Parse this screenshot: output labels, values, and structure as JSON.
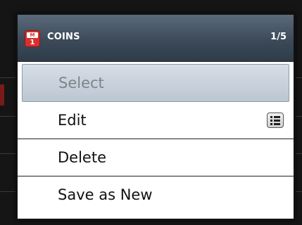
{
  "dialog": {
    "app_icon": {
      "name": "app-m1-icon",
      "top_text": "M",
      "bottom_text": "1",
      "color": "#d9302b"
    },
    "title": "COINS",
    "counter": "1/5"
  },
  "menu": {
    "items": [
      {
        "label": "Select",
        "state": "highlighted"
      },
      {
        "label": "Edit",
        "icon": "list-icon"
      },
      {
        "label": "Delete"
      },
      {
        "label": "Save as New"
      }
    ]
  }
}
